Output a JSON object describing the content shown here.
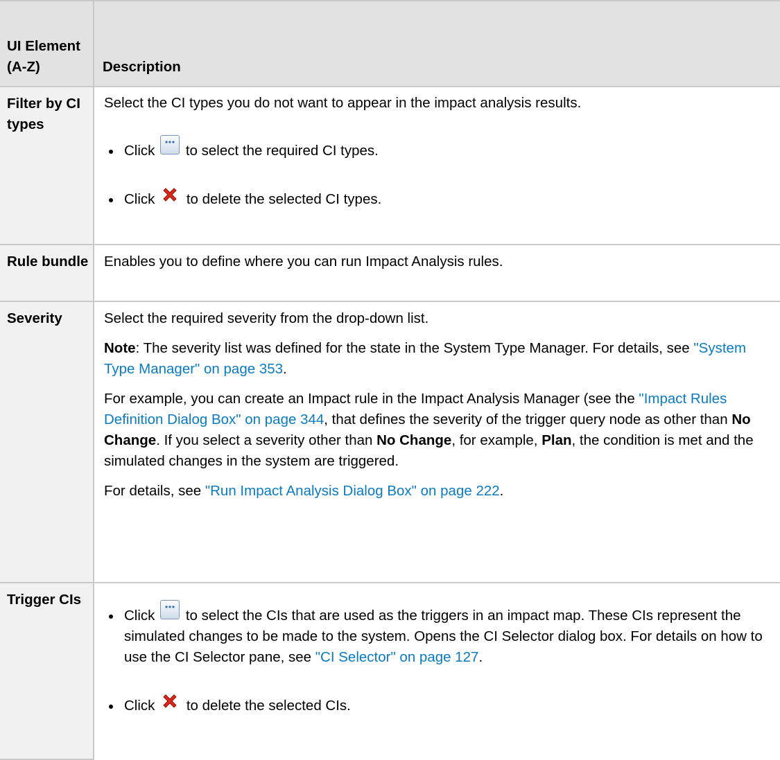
{
  "table": {
    "headers": {
      "element": "UI Element (A-Z)",
      "description": "Description"
    },
    "rows": {
      "filter": {
        "element": "Filter by CI types",
        "intro": "Select the CI types you do not want to appear in the impact analysis results.",
        "b1_pre": "Click",
        "b1_post": "to select the required CI types.",
        "b2_pre": "Click",
        "b2_post": "to delete the selected CI types."
      },
      "rule_bundle": {
        "element": "Rule bundle",
        "text": "Enables you to define where you can run Impact Analysis rules."
      },
      "severity": {
        "element": "Severity",
        "p1": "Select the required severity from the drop-down list.",
        "note_label": "Note",
        "note_text": ": The severity list was defined for the state in the System Type Manager. For details, see ",
        "note_link": "\"System Type Manager\" on page 353",
        "note_end": ".",
        "ex_1": "For example, you can create an Impact rule in the Impact Analysis Manager (see the ",
        "ex_link": "\"Impact Rules Definition Dialog Box\" on page 344",
        "ex_2": ", that defines the severity of the trigger query node as other than ",
        "ex_bold1": "No Change",
        "ex_3": ". If you select a severity other than ",
        "ex_bold2": "No Change",
        "ex_4": ", for example, ",
        "ex_bold3": "Plan",
        "ex_5": ", the condition is met and the simulated changes in the system are triggered.",
        "details_text": "For details, see ",
        "details_link": "\"Run Impact Analysis Dialog Box\" on page 222",
        "details_end": "."
      },
      "trigger": {
        "element": "Trigger CIs",
        "b1_pre": "Click",
        "b1_post": "to select the CIs that are used as the triggers in an impact map. These CIs represent the simulated changes to be made to the system. Opens the CI Selector dialog box. For details on how to use the CI Selector pane, see ",
        "b1_link": "\"CI Selector\" on page 127",
        "b1_end": ".",
        "b2_pre": "Click",
        "b2_post": "to delete the selected CIs."
      }
    }
  },
  "icons": {
    "browse": "ellipsis-browse-icon",
    "delete": "red-x-delete-icon"
  },
  "colors": {
    "link": "#0a7bc0",
    "header_bg": "#e2e2e2",
    "element_col_bg": "#f1f1f1",
    "border": "#c9c9c9",
    "delete_icon": "#d8291a"
  }
}
